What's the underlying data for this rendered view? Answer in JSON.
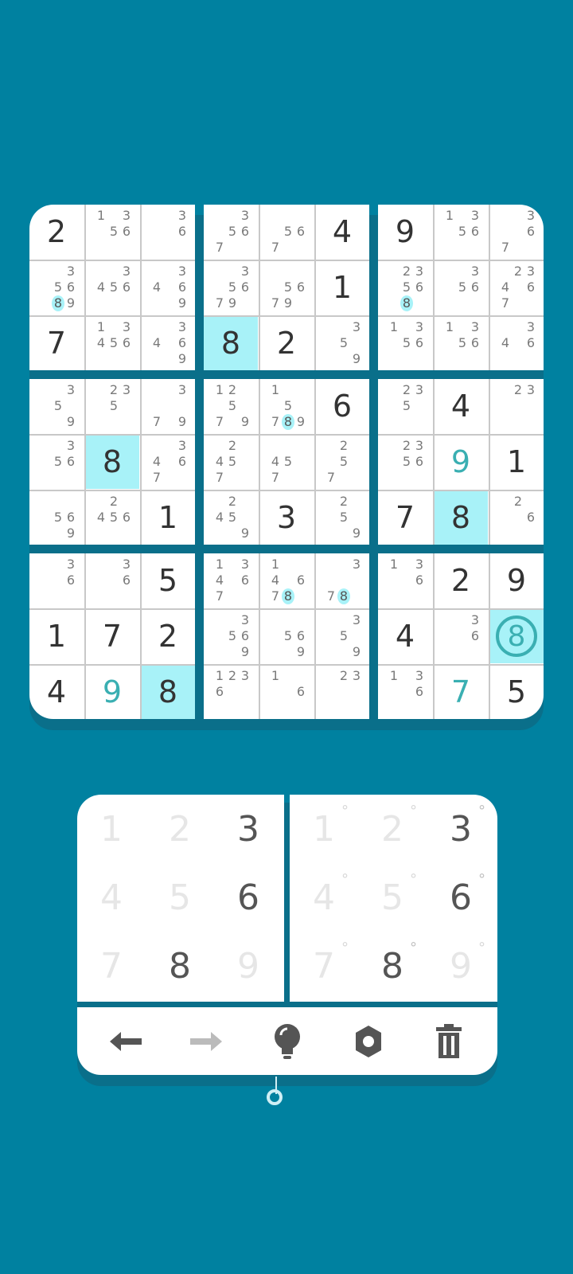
{
  "colors": {
    "background": "#0081A0",
    "highlight": "#A8F2F8",
    "user_digit": "#3AAFB2",
    "given_digit": "#333333"
  },
  "grid": [
    [
      {
        "v": "2"
      },
      {
        "n": "1 3 56 "
      },
      {
        "n": "  3  6   "
      },
      {
        "n": "  3 567  "
      },
      {
        "n": "    567  "
      },
      {
        "v": "4"
      },
      {
        "v": "9"
      },
      {
        "n": "1 3 56   "
      },
      {
        "n": "  3  67  "
      }
    ],
    [
      {
        "n": "  3 56 89",
        "hot": "8"
      },
      {
        "n": "  3456   "
      },
      {
        "n": "  34 6  9"
      },
      {
        "n": "  3 5679 "
      },
      {
        "n": "    5679 "
      },
      {
        "v": "1"
      },
      {
        "n": " 23 56 8 ",
        "hot": "8"
      },
      {
        "n": "  3 56   "
      },
      {
        "n": " 234 67  "
      }
    ],
    [
      {
        "v": "7"
      },
      {
        "n": "1 3456   "
      },
      {
        "n": "  34 6  9"
      },
      {
        "v": "8",
        "hl": true
      },
      {
        "v": "2"
      },
      {
        "n": "  3 5   9"
      },
      {
        "n": "1 3 56   "
      },
      {
        "n": "1 3 56   "
      },
      {
        "n": "  34 6   "
      }
    ],
    [
      {
        "n": "  3 5   9"
      },
      {
        "n": " 23 5    "
      },
      {
        "n": "  3   7 9"
      },
      {
        "n": "12  5 7 9"
      },
      {
        "n": "1   5 789",
        "hot": "8"
      },
      {
        "v": "6"
      },
      {
        "n": " 23 5    "
      },
      {
        "v": "4"
      },
      {
        "n": " 23      "
      }
    ],
    [
      {
        "n": "  3 56   "
      },
      {
        "v": "8",
        "hl": true
      },
      {
        "n": "  34 67  "
      },
      {
        "n": " 2 45 7  "
      },
      {
        "n": "   45 7  "
      },
      {
        "n": " 2  5 7  "
      },
      {
        "n": " 23 56   "
      },
      {
        "v": "9",
        "user": true
      },
      {
        "v": "1"
      }
    ],
    [
      {
        "n": "    56  9"
      },
      {
        "n": " 2 456   "
      },
      {
        "v": "1"
      },
      {
        "n": " 2 45   9"
      },
      {
        "v": "3"
      },
      {
        "n": " 2  5   9"
      },
      {
        "v": "7"
      },
      {
        "v": "8",
        "hl": true
      },
      {
        "n": " 2   6   "
      }
    ],
    [
      {
        "n": "  3  6   "
      },
      {
        "n": "  3  6   "
      },
      {
        "v": "5"
      },
      {
        "n": "1 34 67  "
      },
      {
        "n": "1  4 678 ",
        "hot": "8"
      },
      {
        "n": "  3   78 ",
        "hot": "8"
      },
      {
        "n": "1 3  6   "
      },
      {
        "v": "2"
      },
      {
        "v": "9"
      }
    ],
    [
      {
        "v": "1"
      },
      {
        "v": "7"
      },
      {
        "v": "2"
      },
      {
        "n": "  3 56  9"
      },
      {
        "n": "    56  9"
      },
      {
        "n": "  3 5   9"
      },
      {
        "v": "4"
      },
      {
        "n": "  3  6   "
      },
      {
        "v": "8",
        "hl": true,
        "ring": true,
        "user": true
      }
    ],
    [
      {
        "v": "4"
      },
      {
        "v": "9",
        "user": true
      },
      {
        "v": "8",
        "hl": true
      },
      {
        "n": "1236     "
      },
      {
        "n": "1    6   "
      },
      {
        "n": " 23      "
      },
      {
        "n": "1 3  6   "
      },
      {
        "v": "7",
        "user": true
      },
      {
        "v": "5"
      }
    ]
  ],
  "number_pad": {
    "values": [
      "1",
      "2",
      "3",
      "4",
      "5",
      "6",
      "7",
      "8",
      "9"
    ],
    "enabled": [
      false,
      false,
      true,
      false,
      false,
      true,
      false,
      true,
      false
    ]
  },
  "note_pad": {
    "values": [
      "1",
      "2",
      "3",
      "4",
      "5",
      "6",
      "7",
      "8",
      "9"
    ],
    "enabled": [
      false,
      false,
      true,
      false,
      false,
      true,
      false,
      true,
      false
    ],
    "marker": "°"
  },
  "toolbar": {
    "icons": [
      "undo-arrow-icon",
      "redo-arrow-icon",
      "hint-bulb-icon",
      "settings-gear-icon",
      "trash-icon"
    ]
  }
}
